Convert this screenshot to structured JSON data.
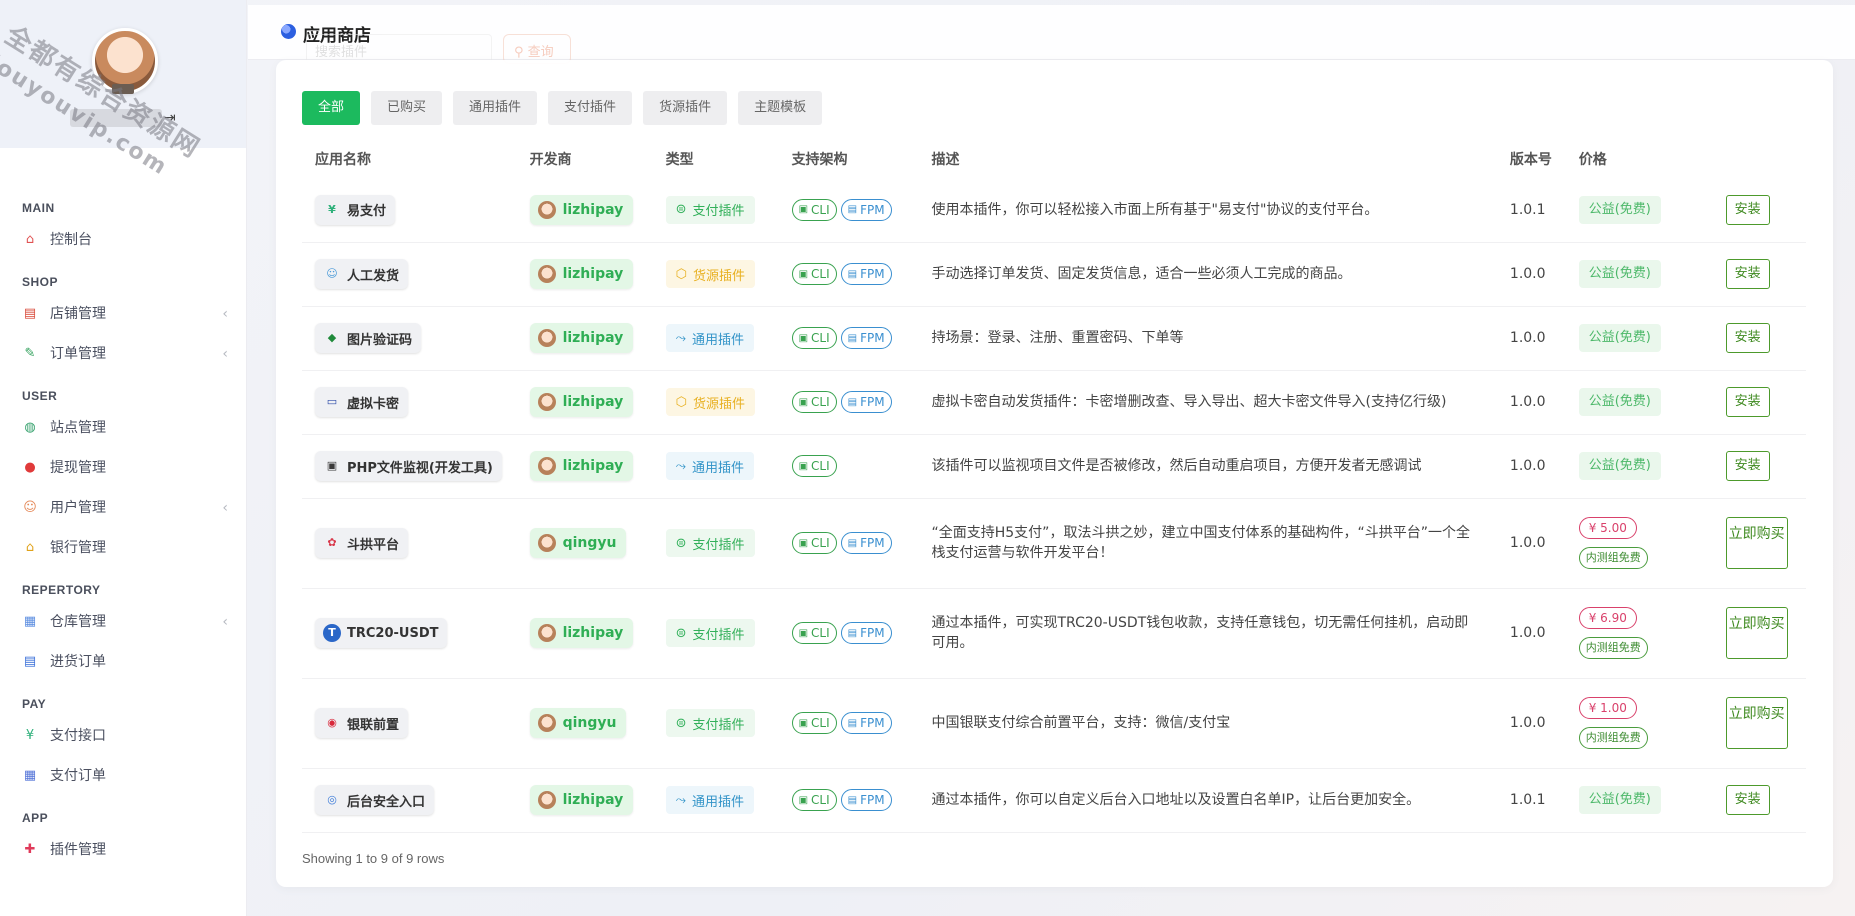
{
  "watermark": {
    "line1": "全都有综合资源网",
    "line2": "douyouvip.com"
  },
  "profile": {
    "name": "",
    "logout_icon": "logout-icon"
  },
  "sidebar": {
    "groups": [
      {
        "title": "MAIN",
        "items": [
          {
            "label": "控制台",
            "icon": "home-icon",
            "has_chevron": false
          }
        ]
      },
      {
        "title": "SHOP",
        "items": [
          {
            "label": "店铺管理",
            "icon": "store-icon",
            "has_chevron": true
          },
          {
            "label": "订单管理",
            "icon": "order-edit-icon",
            "has_chevron": true
          }
        ]
      },
      {
        "title": "USER",
        "items": [
          {
            "label": "站点管理",
            "icon": "www-icon",
            "has_chevron": false
          },
          {
            "label": "提现管理",
            "icon": "withdraw-icon",
            "has_chevron": false
          },
          {
            "label": "用户管理",
            "icon": "users-icon",
            "has_chevron": true
          },
          {
            "label": "银行管理",
            "icon": "bank-icon",
            "has_chevron": false
          }
        ]
      },
      {
        "title": "REPERTORY",
        "items": [
          {
            "label": "仓库管理",
            "icon": "warehouse-icon",
            "has_chevron": true
          },
          {
            "label": "进货订单",
            "icon": "purchase-icon",
            "has_chevron": false
          }
        ]
      },
      {
        "title": "PAY",
        "items": [
          {
            "label": "支付接口",
            "icon": "yen-icon",
            "has_chevron": false
          },
          {
            "label": "支付订单",
            "icon": "pay-order-icon",
            "has_chevron": false
          }
        ]
      },
      {
        "title": "APP",
        "items": [
          {
            "label": "插件管理",
            "icon": "puzzle-icon",
            "has_chevron": false
          }
        ]
      }
    ]
  },
  "header": {
    "title": "应用商店",
    "search_placeholder": "搜索插件",
    "search_button": "查询"
  },
  "tabs": [
    {
      "label": "全部",
      "active": true
    },
    {
      "label": "已购买",
      "active": false
    },
    {
      "label": "通用插件",
      "active": false
    },
    {
      "label": "支付插件",
      "active": false
    },
    {
      "label": "货源插件",
      "active": false
    },
    {
      "label": "主题模板",
      "active": false
    }
  ],
  "table": {
    "columns": [
      "应用名称",
      "开发商",
      "类型",
      "支持架构",
      "描述",
      "版本号",
      "价格",
      ""
    ],
    "rows": [
      {
        "name": "易支付",
        "icon": "yen-icon",
        "developer": "lizhipay",
        "type": "支付插件",
        "type_kind": "pay",
        "arch": [
          "CLI",
          "FPM"
        ],
        "description": "使用本插件，你可以轻松接入市面上所有基于\"易支付\"协议的支付平台。",
        "version": "1.0.1",
        "price": "公益(免费)",
        "action": "安装"
      },
      {
        "name": "人工发货",
        "icon": "person-icon",
        "developer": "lizhipay",
        "type": "货源插件",
        "type_kind": "source",
        "arch": [
          "CLI",
          "FPM"
        ],
        "description": "手动选择订单发货、固定发货信息，适合一些必须人工完成的商品。",
        "version": "1.0.0",
        "price": "公益(免费)",
        "action": "安装"
      },
      {
        "name": "图片验证码",
        "icon": "shield-icon",
        "developer": "lizhipay",
        "type": "通用插件",
        "type_kind": "general",
        "arch": [
          "CLI",
          "FPM"
        ],
        "description": "持场景：登录、注册、重置密码、下单等",
        "version": "1.0.0",
        "price": "公益(免费)",
        "action": "安装"
      },
      {
        "name": "虚拟卡密",
        "icon": "card-icon",
        "developer": "lizhipay",
        "type": "货源插件",
        "type_kind": "source",
        "arch": [
          "CLI",
          "FPM"
        ],
        "description": "虚拟卡密自动发货插件：卡密增删改查、导入导出、超大卡密文件导入(支持亿行级)",
        "version": "1.0.0",
        "price": "公益(免费)",
        "action": "安装"
      },
      {
        "name": "PHP文件监视(开发工具)",
        "icon": "file-watch-icon",
        "developer": "lizhipay",
        "type": "通用插件",
        "type_kind": "general",
        "arch": [
          "CLI"
        ],
        "description": "该插件可以监视项目文件是否被修改，然后自动重启项目，方便开发者无感调试",
        "version": "1.0.0",
        "price": "公益(免费)",
        "action": "安装"
      },
      {
        "name": "斗拱平台",
        "icon": "doukong-icon",
        "developer": "qingyu",
        "type": "支付插件",
        "type_kind": "pay",
        "arch": [
          "CLI",
          "FPM"
        ],
        "description": "“全面支持H5支付”，取法斗拱之妙，建立中国支付体系的基础构件，“斗拱平台”一个全栈支付运营与软件开发平台！",
        "version": "1.0.0",
        "price": "¥ 5.00",
        "price_note": "内测组免费",
        "action": "立即购买"
      },
      {
        "name": "TRC20-USDT",
        "icon": "tether-icon",
        "developer": "lizhipay",
        "type": "支付插件",
        "type_kind": "pay",
        "arch": [
          "CLI",
          "FPM"
        ],
        "description": "通过本插件，可实现TRC20-USDT钱包收款，支持任意钱包，切无需任何挂机，启动即可用。",
        "version": "1.0.0",
        "price": "¥ 6.90",
        "price_note": "内测组免费",
        "action": "立即购买"
      },
      {
        "name": "银联前置",
        "icon": "unionpay-icon",
        "developer": "qingyu",
        "type": "支付插件",
        "type_kind": "pay",
        "arch": [
          "CLI",
          "FPM"
        ],
        "description": "中国银联支付综合前置平台，支持：微信/支付宝",
        "version": "1.0.0",
        "price": "¥ 1.00",
        "price_note": "内测组免费",
        "action": "立即购买"
      },
      {
        "name": "后台安全入口",
        "icon": "security-gate-icon",
        "developer": "lizhipay",
        "type": "通用插件",
        "type_kind": "general",
        "arch": [
          "CLI",
          "FPM"
        ],
        "description": "通过本插件，你可以自定义后台入口地址以及设置白名单IP，让后台更加安全。",
        "version": "1.0.1",
        "price": "公益(免费)",
        "action": "安装"
      }
    ]
  },
  "pagination": {
    "summary": "Showing 1 to 9 of 9 rows"
  }
}
